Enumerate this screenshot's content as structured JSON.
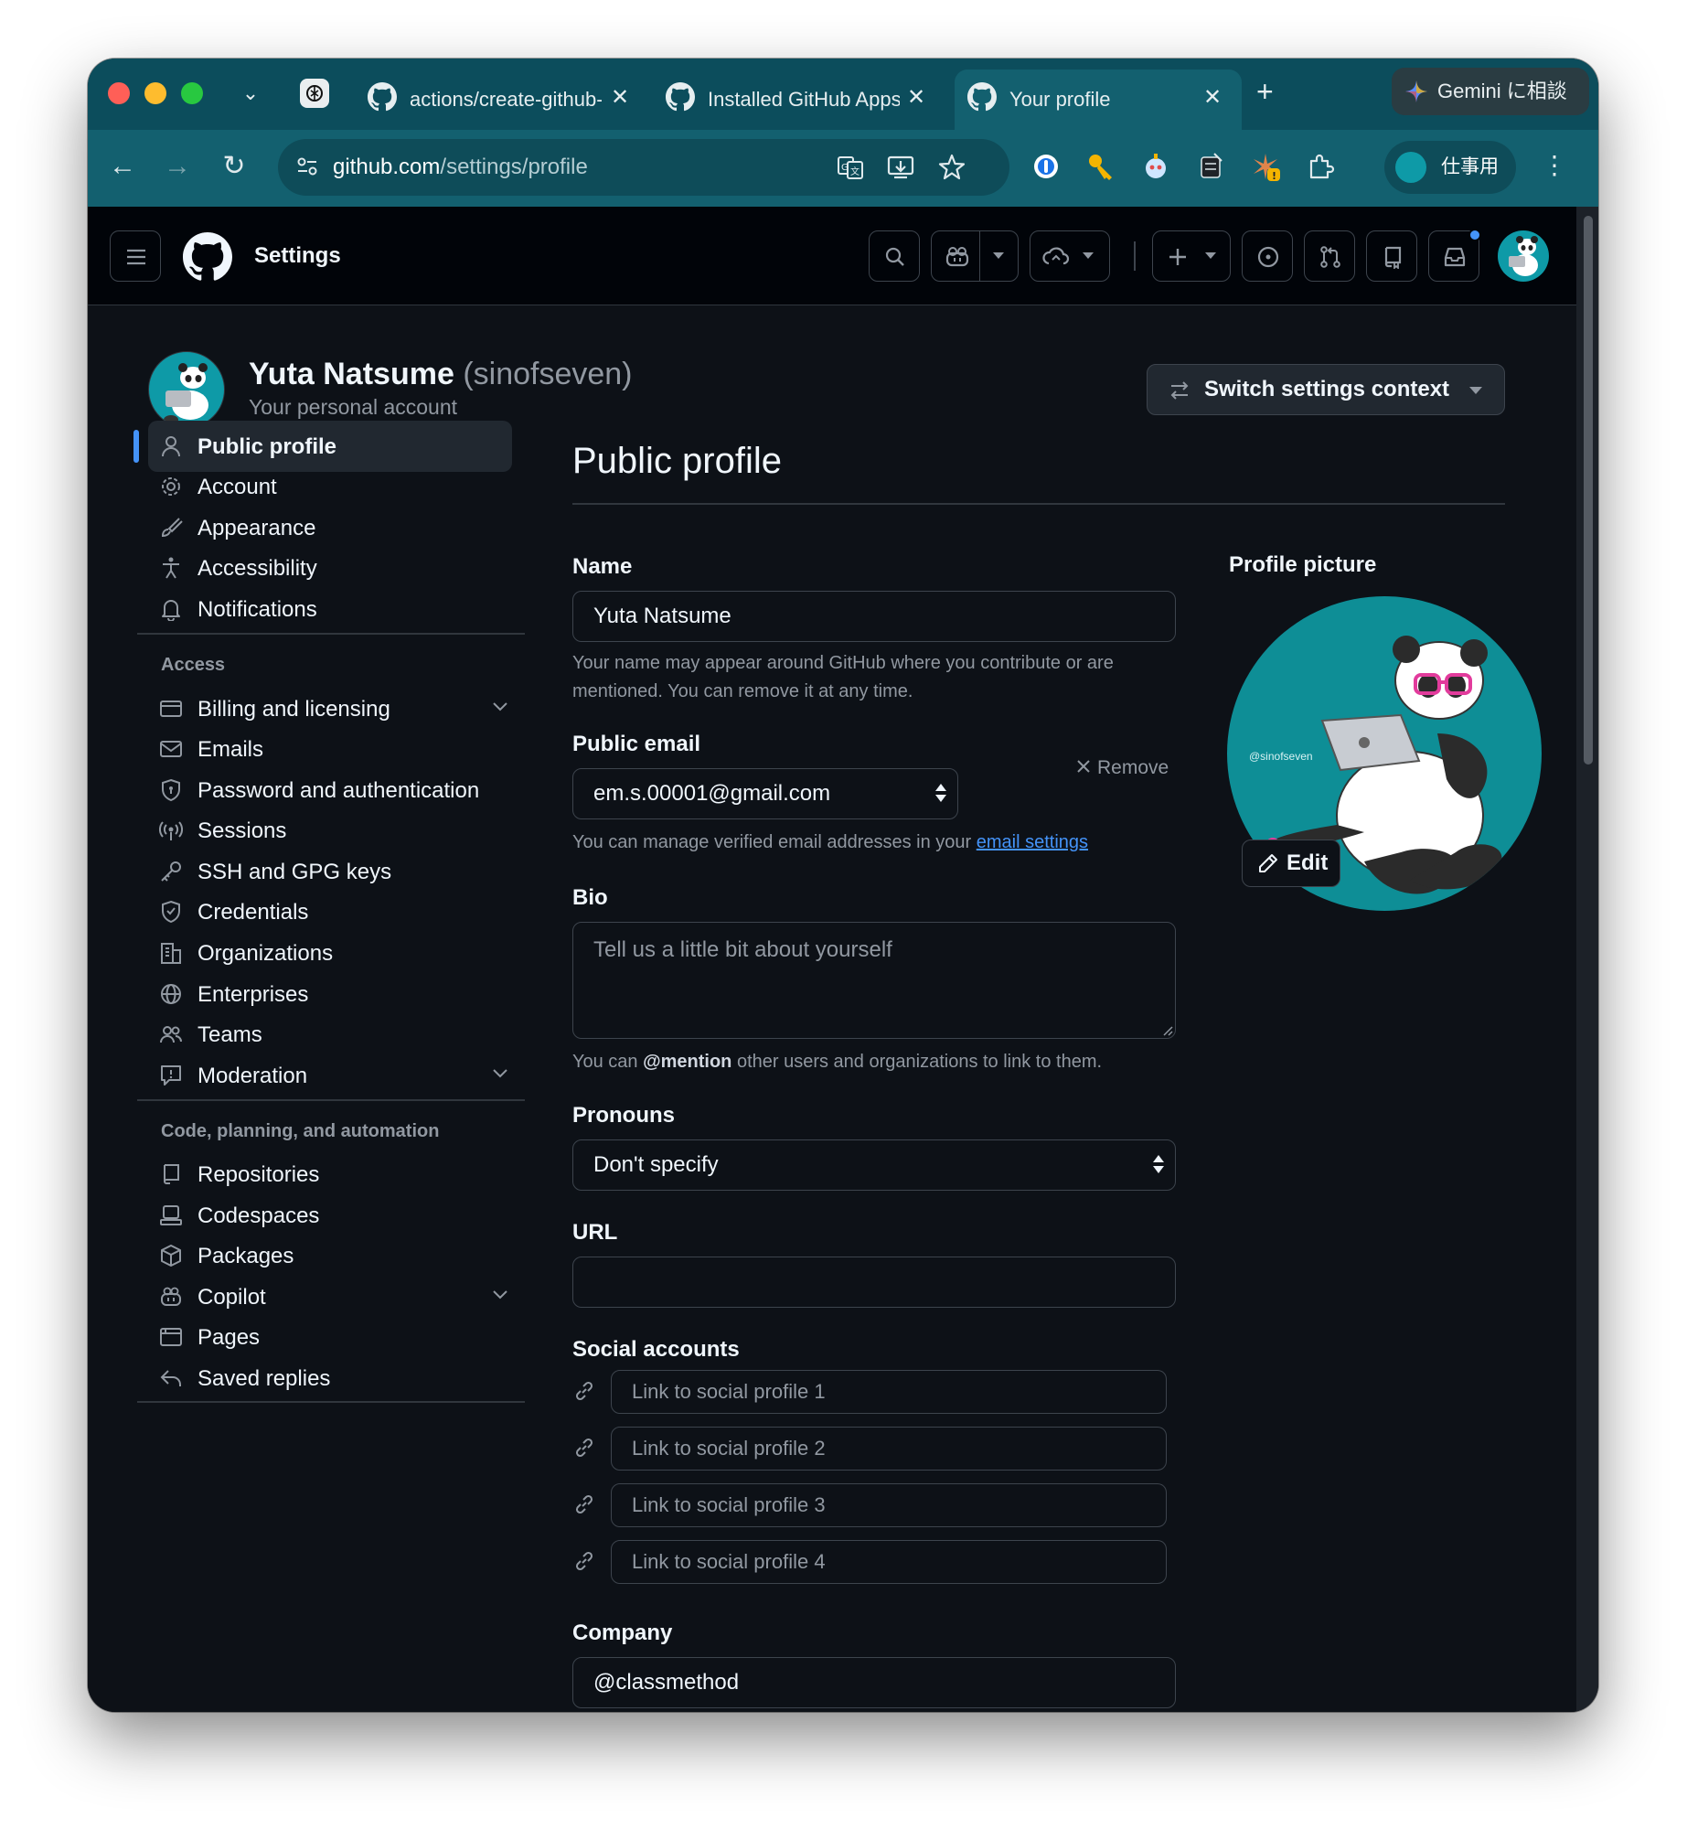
{
  "browser": {
    "tabs": [
      {
        "title": "actions/create-github-app-token"
      },
      {
        "title": "Installed GitHub Apps"
      },
      {
        "title": "Your profile"
      }
    ],
    "new_tab": "+",
    "gemini_label": "Gemini に相談",
    "url_host": "github.com",
    "url_path": "/settings/profile",
    "profile_label": "仕事用"
  },
  "header": {
    "title": "Settings"
  },
  "user": {
    "name": "Yuta Natsume",
    "login": "(sinofseven)",
    "subtitle": "Your personal account",
    "switch_context": "Switch settings context"
  },
  "sidebar": {
    "items": [
      {
        "label": "Public profile",
        "icon": "person-icon",
        "active": true
      },
      {
        "label": "Account",
        "icon": "gear-icon"
      },
      {
        "label": "Appearance",
        "icon": "paintbrush-icon"
      },
      {
        "label": "Accessibility",
        "icon": "accessibility-icon"
      },
      {
        "label": "Notifications",
        "icon": "bell-icon"
      }
    ],
    "access_heading": "Access",
    "access_items": [
      {
        "label": "Billing and licensing",
        "icon": "credit-card-icon",
        "expandable": true
      },
      {
        "label": "Emails",
        "icon": "mail-icon"
      },
      {
        "label": "Password and authentication",
        "icon": "shield-lock-icon"
      },
      {
        "label": "Sessions",
        "icon": "broadcast-icon"
      },
      {
        "label": "SSH and GPG keys",
        "icon": "key-icon"
      },
      {
        "label": "Credentials",
        "icon": "shield-check-icon"
      },
      {
        "label": "Organizations",
        "icon": "organization-icon"
      },
      {
        "label": "Enterprises",
        "icon": "globe-icon"
      },
      {
        "label": "Teams",
        "icon": "people-icon"
      },
      {
        "label": "Moderation",
        "icon": "report-icon",
        "expandable": true
      }
    ],
    "code_heading": "Code, planning, and automation",
    "code_items": [
      {
        "label": "Repositories",
        "icon": "repo-icon"
      },
      {
        "label": "Codespaces",
        "icon": "codespaces-icon"
      },
      {
        "label": "Packages",
        "icon": "package-icon"
      },
      {
        "label": "Copilot",
        "icon": "copilot-icon",
        "expandable": true
      },
      {
        "label": "Pages",
        "icon": "browser-icon"
      },
      {
        "label": "Saved replies",
        "icon": "reply-icon"
      }
    ]
  },
  "main": {
    "title": "Public profile",
    "name": {
      "label": "Name",
      "value": "Yuta Natsume",
      "note": "Your name may appear around GitHub where you contribute or are mentioned. You can remove it at any time."
    },
    "public_email": {
      "label": "Public email",
      "value": "em.s.00001@gmail.com",
      "remove": "Remove",
      "note_before": "You can manage verified email addresses in your ",
      "note_link": "email settings"
    },
    "bio": {
      "label": "Bio",
      "placeholder": "Tell us a little bit about yourself",
      "note_before": "You can ",
      "note_bold": "@mention",
      "note_after": " other users and organizations to link to them."
    },
    "pronouns": {
      "label": "Pronouns",
      "value": "Don't specify"
    },
    "url": {
      "label": "URL",
      "value": ""
    },
    "social": {
      "label": "Social accounts",
      "placeholders": [
        "Link to social profile 1",
        "Link to social profile 2",
        "Link to social profile 3",
        "Link to social profile 4"
      ]
    },
    "company": {
      "label": "Company",
      "value": "@classmethod"
    },
    "profile_picture": {
      "label": "Profile picture",
      "watermark": "@sinofseven",
      "edit": "Edit"
    }
  },
  "colors": {
    "accent": "#4493f8",
    "tabstrip": "#0c4d5c",
    "toolbar": "#13606f",
    "avatar_bg": "#0e8e96",
    "page_bg": "#0d1117"
  }
}
